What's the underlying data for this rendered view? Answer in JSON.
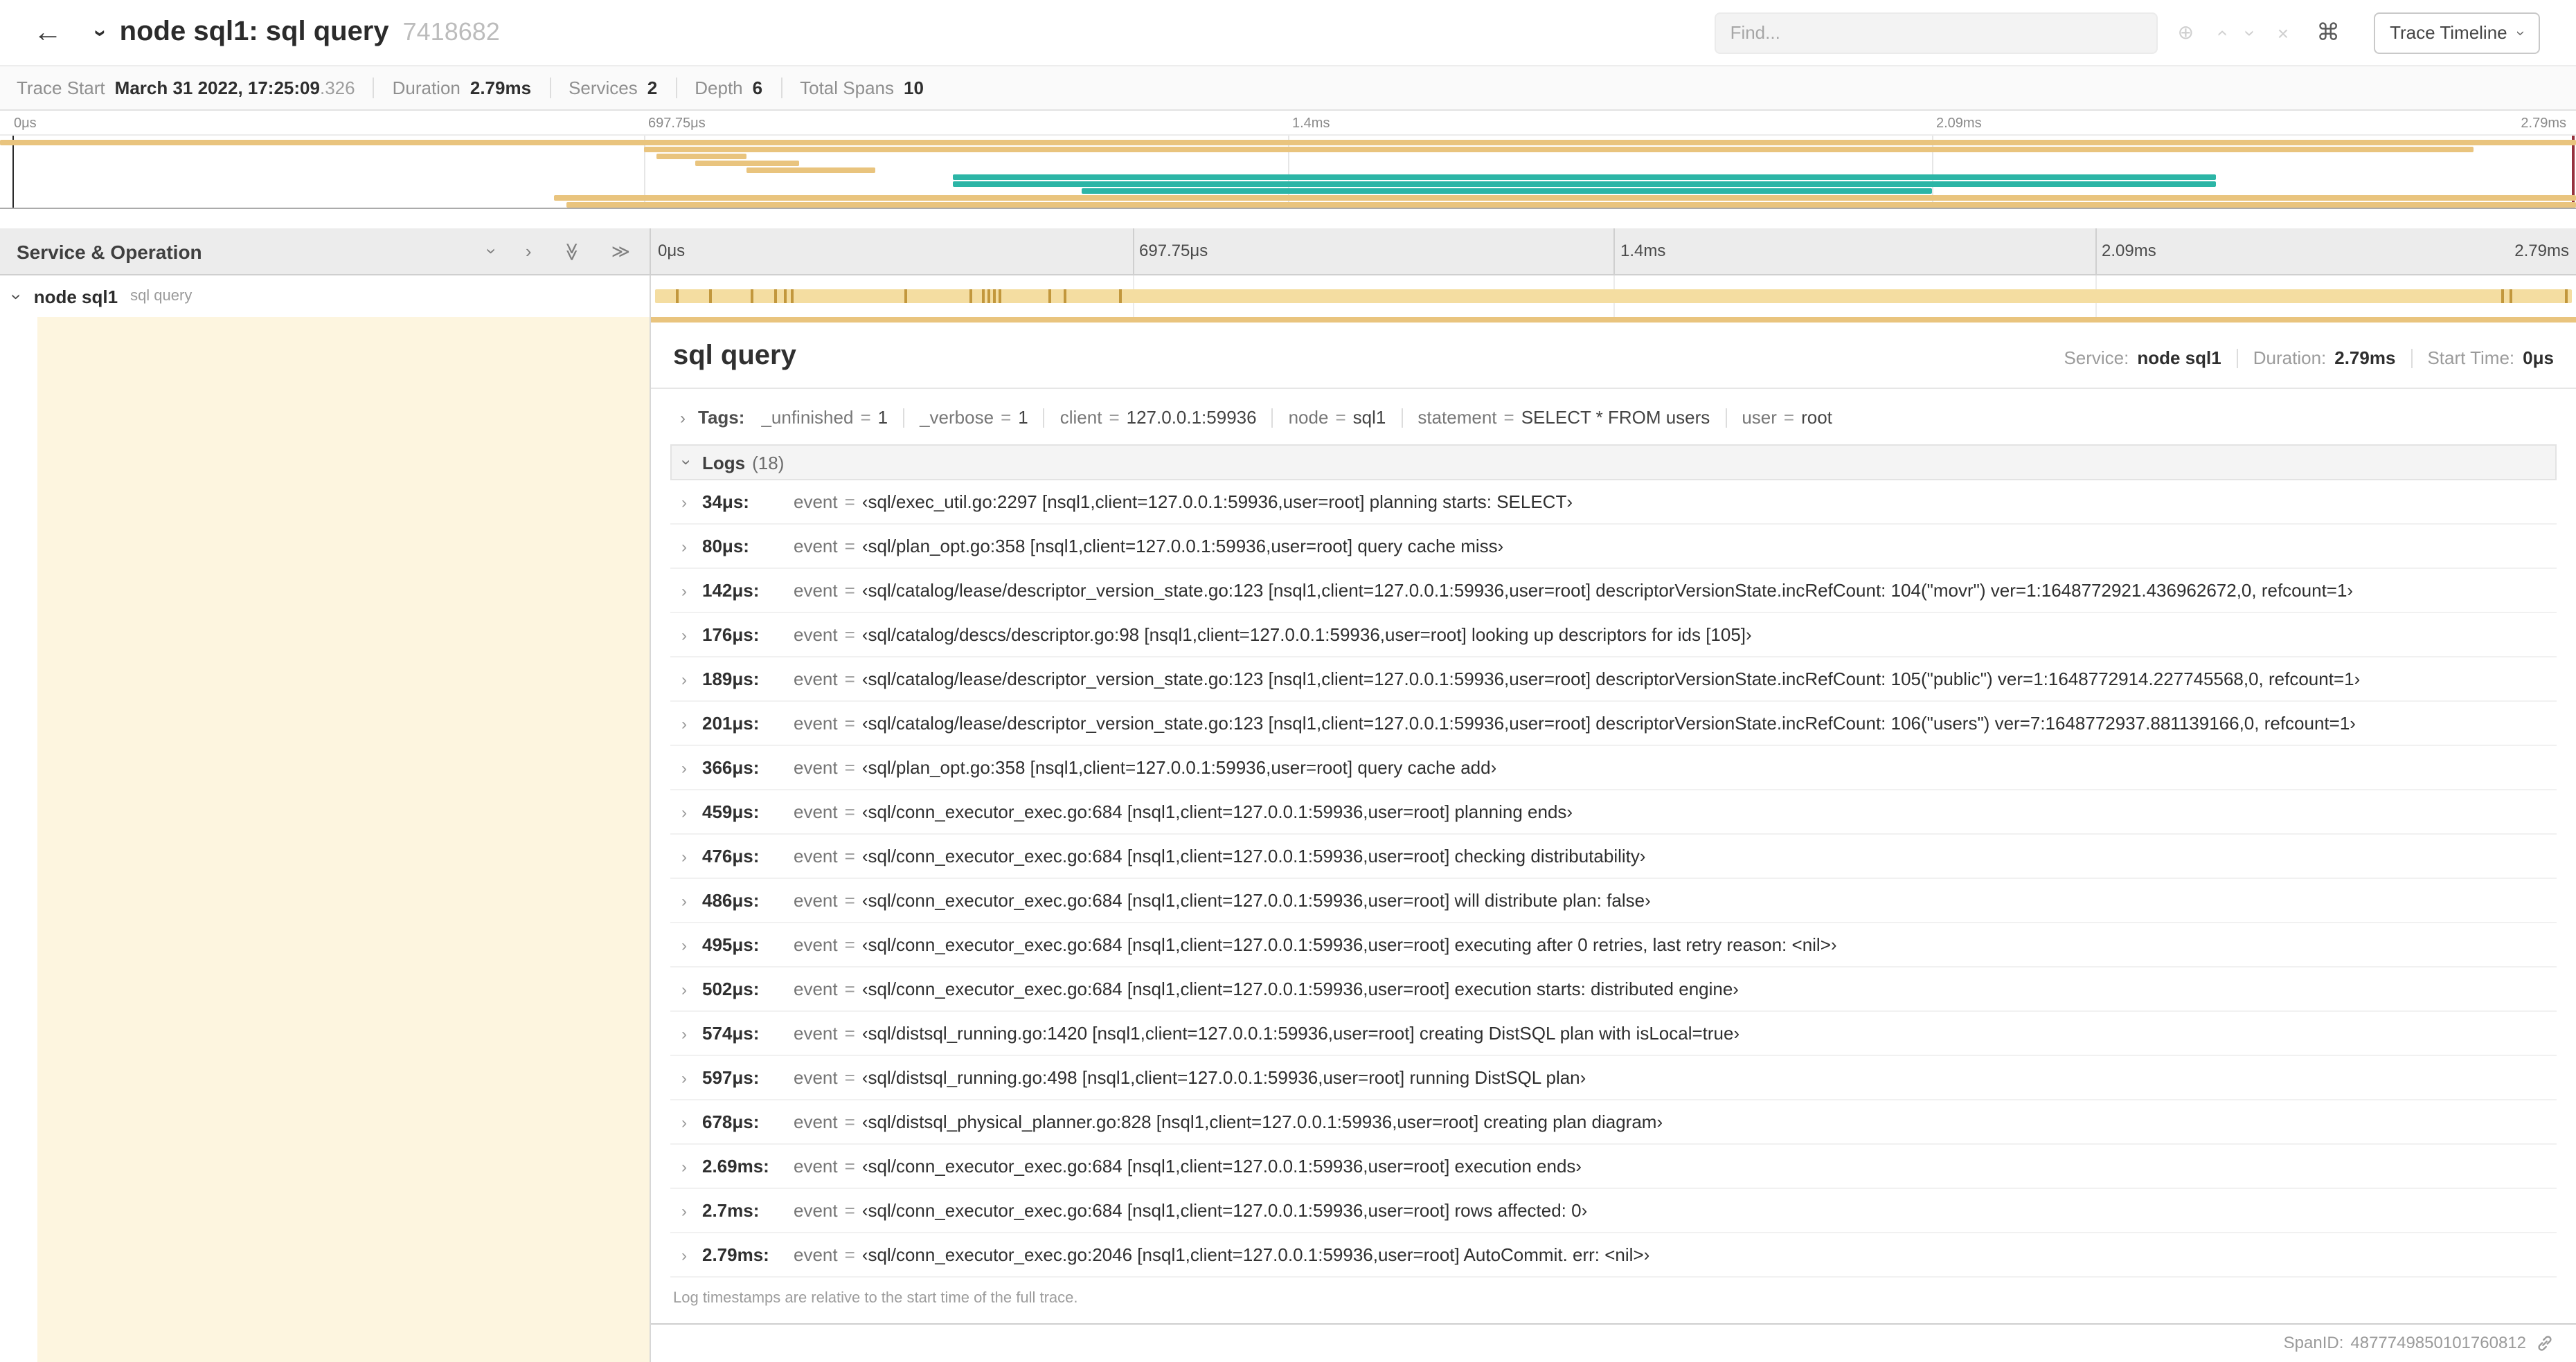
{
  "colors": {
    "tan": "#e9c47e",
    "teal": "#2cb5a6",
    "bar": "#f4dda1",
    "tick": "#c2973c"
  },
  "icons": {
    "back": "←",
    "chevron": "›",
    "double_chevron": "≫",
    "circle_plus": "⊕",
    "close": "×",
    "command": "⌘"
  },
  "header": {
    "title": "node sql1: sql query",
    "trace_id": "7418682",
    "find_placeholder": "Find...",
    "view_button_label": "Trace Timeline"
  },
  "summary": {
    "items": [
      {
        "label": "Trace Start",
        "value": "March 31 2022, 17:25:09",
        "suffix": ".326"
      },
      {
        "label": "Duration",
        "value": "2.79ms"
      },
      {
        "label": "Services",
        "value": "2"
      },
      {
        "label": "Depth",
        "value": "6"
      },
      {
        "label": "Total Spans",
        "value": "10"
      }
    ]
  },
  "minimap": {
    "ticks": [
      "0μs",
      "697.75μs",
      "1.4ms",
      "2.09ms",
      "2.79ms"
    ],
    "spans": [
      {
        "row": 0,
        "start": 0,
        "width": 100,
        "color": "tan"
      },
      {
        "row": 1,
        "start": 25,
        "width": 71,
        "color": "tan"
      },
      {
        "row": 2,
        "start": 25.5,
        "width": 3.5,
        "color": "tan"
      },
      {
        "row": 3,
        "start": 27,
        "width": 4,
        "color": "tan"
      },
      {
        "row": 4,
        "start": 29,
        "width": 5,
        "color": "tan"
      },
      {
        "row": 5,
        "start": 37,
        "width": 49,
        "color": "teal"
      },
      {
        "row": 6,
        "start": 37,
        "width": 49,
        "color": "teal"
      },
      {
        "row": 7,
        "start": 42,
        "width": 33,
        "color": "teal"
      },
      {
        "row": 8,
        "start": 21.5,
        "width": 78.5,
        "color": "tan"
      },
      {
        "row": 9,
        "start": 22,
        "width": 78,
        "color": "tan"
      }
    ]
  },
  "timeline": {
    "left_header": "Service & Operation",
    "ticks": [
      "0μs",
      "697.75μs",
      "1.4ms",
      "2.09ms",
      "2.79ms"
    ],
    "row": {
      "service": "node sql1",
      "operation": "sql query"
    },
    "log_markers": [
      1.2,
      2.9,
      5.1,
      6.3,
      6.8,
      7.2,
      13.1,
      16.5,
      17.1,
      17.4,
      17.7,
      18,
      20.6,
      21.4,
      24.3,
      96.4,
      96.8,
      99.7
    ]
  },
  "detail": {
    "title": "sql query",
    "eq": "=",
    "overview": {
      "service_label": "Service:",
      "service_value": "node sql1",
      "duration_label": "Duration:",
      "duration_value": "2.79ms",
      "start_label": "Start Time:",
      "start_value": "0μs"
    },
    "tags_label": "Tags:",
    "tags": [
      {
        "key": "_unfinished",
        "value": "1"
      },
      {
        "key": "_verbose",
        "value": "1"
      },
      {
        "key": "client",
        "value": "127.0.0.1:59936"
      },
      {
        "key": "node",
        "value": "sql1"
      },
      {
        "key": "statement",
        "value": "SELECT * FROM users"
      },
      {
        "key": "user",
        "value": "root"
      }
    ],
    "logs_label": "Logs",
    "logs_count": "(18)",
    "log_key": "event",
    "logs": [
      {
        "time": "34μs:",
        "value": "‹sql/exec_util.go:2297 [nsql1,client=127.0.0.1:59936,user=root] planning starts: SELECT›"
      },
      {
        "time": "80μs:",
        "value": "‹sql/plan_opt.go:358 [nsql1,client=127.0.0.1:59936,user=root] query cache miss›"
      },
      {
        "time": "142μs:",
        "value": "‹sql/catalog/lease/descriptor_version_state.go:123 [nsql1,client=127.0.0.1:59936,user=root] descriptorVersionState.incRefCount: 104(\"movr\") ver=1:1648772921.436962672,0, refcount=1›"
      },
      {
        "time": "176μs:",
        "value": "‹sql/catalog/descs/descriptor.go:98 [nsql1,client=127.0.0.1:59936,user=root] looking up descriptors for ids [105]›"
      },
      {
        "time": "189μs:",
        "value": "‹sql/catalog/lease/descriptor_version_state.go:123 [nsql1,client=127.0.0.1:59936,user=root] descriptorVersionState.incRefCount: 105(\"public\") ver=1:1648772914.227745568,0, refcount=1›"
      },
      {
        "time": "201μs:",
        "value": "‹sql/catalog/lease/descriptor_version_state.go:123 [nsql1,client=127.0.0.1:59936,user=root] descriptorVersionState.incRefCount: 106(\"users\") ver=7:1648772937.881139166,0, refcount=1›"
      },
      {
        "time": "366μs:",
        "value": "‹sql/plan_opt.go:358 [nsql1,client=127.0.0.1:59936,user=root] query cache add›"
      },
      {
        "time": "459μs:",
        "value": "‹sql/conn_executor_exec.go:684 [nsql1,client=127.0.0.1:59936,user=root] planning ends›"
      },
      {
        "time": "476μs:",
        "value": "‹sql/conn_executor_exec.go:684 [nsql1,client=127.0.0.1:59936,user=root] checking distributability›"
      },
      {
        "time": "486μs:",
        "value": "‹sql/conn_executor_exec.go:684 [nsql1,client=127.0.0.1:59936,user=root] will distribute plan: false›"
      },
      {
        "time": "495μs:",
        "value": "‹sql/conn_executor_exec.go:684 [nsql1,client=127.0.0.1:59936,user=root] executing after 0 retries, last retry reason: <nil>›"
      },
      {
        "time": "502μs:",
        "value": "‹sql/conn_executor_exec.go:684 [nsql1,client=127.0.0.1:59936,user=root] execution starts: distributed engine›"
      },
      {
        "time": "574μs:",
        "value": "‹sql/distsql_running.go:1420 [nsql1,client=127.0.0.1:59936,user=root] creating DistSQL plan with isLocal=true›"
      },
      {
        "time": "597μs:",
        "value": "‹sql/distsql_running.go:498 [nsql1,client=127.0.0.1:59936,user=root] running DistSQL plan›"
      },
      {
        "time": "678μs:",
        "value": "‹sql/distsql_physical_planner.go:828 [nsql1,client=127.0.0.1:59936,user=root] creating plan diagram›"
      },
      {
        "time": "2.69ms:",
        "value": "‹sql/conn_executor_exec.go:684 [nsql1,client=127.0.0.1:59936,user=root] execution ends›"
      },
      {
        "time": "2.7ms:",
        "value": "‹sql/conn_executor_exec.go:684 [nsql1,client=127.0.0.1:59936,user=root] rows affected: 0›"
      },
      {
        "time": "2.79ms:",
        "value": "‹sql/conn_executor_exec.go:2046 [nsql1,client=127.0.0.1:59936,user=root] AutoCommit. err: <nil>›"
      }
    ],
    "footnote": "Log timestamps are relative to the start time of the full trace.",
    "span_id_label": "SpanID:",
    "span_id": "4877749850101760812"
  }
}
